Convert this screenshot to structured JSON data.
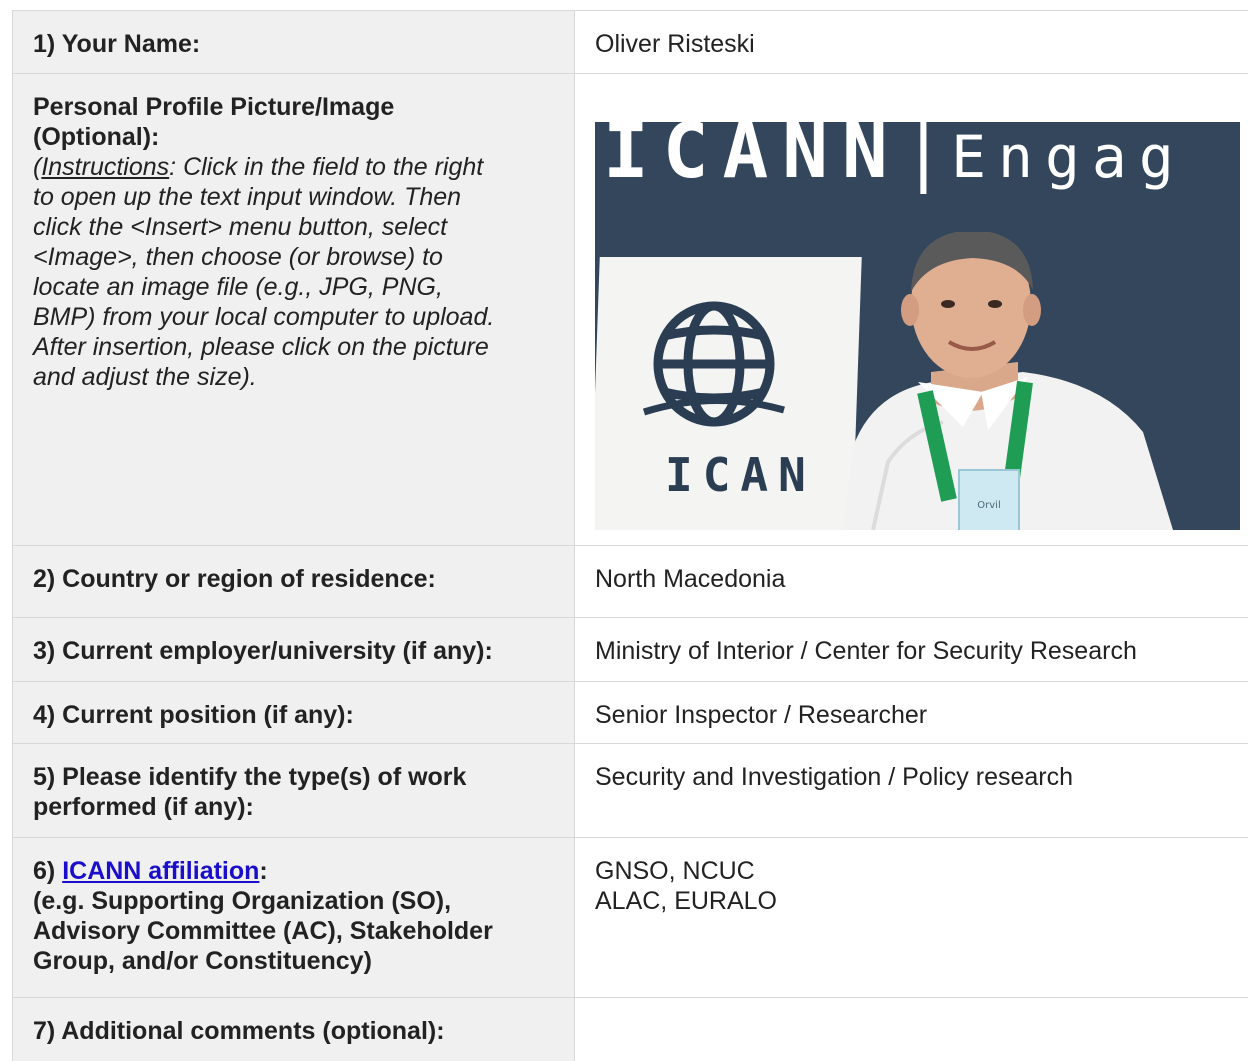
{
  "rows": {
    "name": {
      "label": "1) Your Name:",
      "value": "Oliver Risteski"
    },
    "photo": {
      "label_lines": [
        "Personal Profile Picture/Image",
        "(Optional):"
      ],
      "instr_open": "(",
      "instr_word": "Instructions",
      "instr_rest_line1": ": Click in the field to the right",
      "instr_lines": [
        "to open up the text input window. Then",
        "click the <Insert> menu button, select",
        "<Image>, then choose (or browse) to",
        "locate an image file (e.g., JPG, PNG,",
        "BMP) from your local computer to upload.",
        "After insertion, please click on the picture",
        "and adjust the size)."
      ],
      "banner_brand": "ICANN",
      "banner_sep": "|",
      "banner_engage": "Engag",
      "panel_brand": "ICAN",
      "badge_name": "Orvil"
    },
    "country": {
      "label": "2) Country or region of residence:",
      "value": "North Macedonia"
    },
    "employer": {
      "label": "3) Current employer/university (if any):",
      "value": "Ministry of Interior / Center for Security Research"
    },
    "position": {
      "label": "4) Current position (if any):",
      "value": "Senior Inspector / Researcher"
    },
    "work": {
      "label_lines": [
        "5) Please identify the type(s) of work",
        "performed (if any):"
      ],
      "value": "Security and Investigation / Policy research"
    },
    "affiliation": {
      "label_prefix": "6) ",
      "link_text": "ICANN affiliation",
      "label_suffix": ":",
      "label_lines": [
        "(e.g. Supporting Organization (SO),",
        "Advisory Committee (AC), Stakeholder",
        "Group, and/or Constituency)"
      ],
      "value_lines": [
        "GNSO, NCUC",
        "ALAC, EURALO"
      ]
    },
    "comments": {
      "label": "7) Additional comments (optional):",
      "value": ""
    }
  },
  "colors": {
    "label_bg": "#f0f0f0",
    "border": "#d8d8d8",
    "link": "#1a0dcc",
    "banner_bg": "#33465b"
  }
}
